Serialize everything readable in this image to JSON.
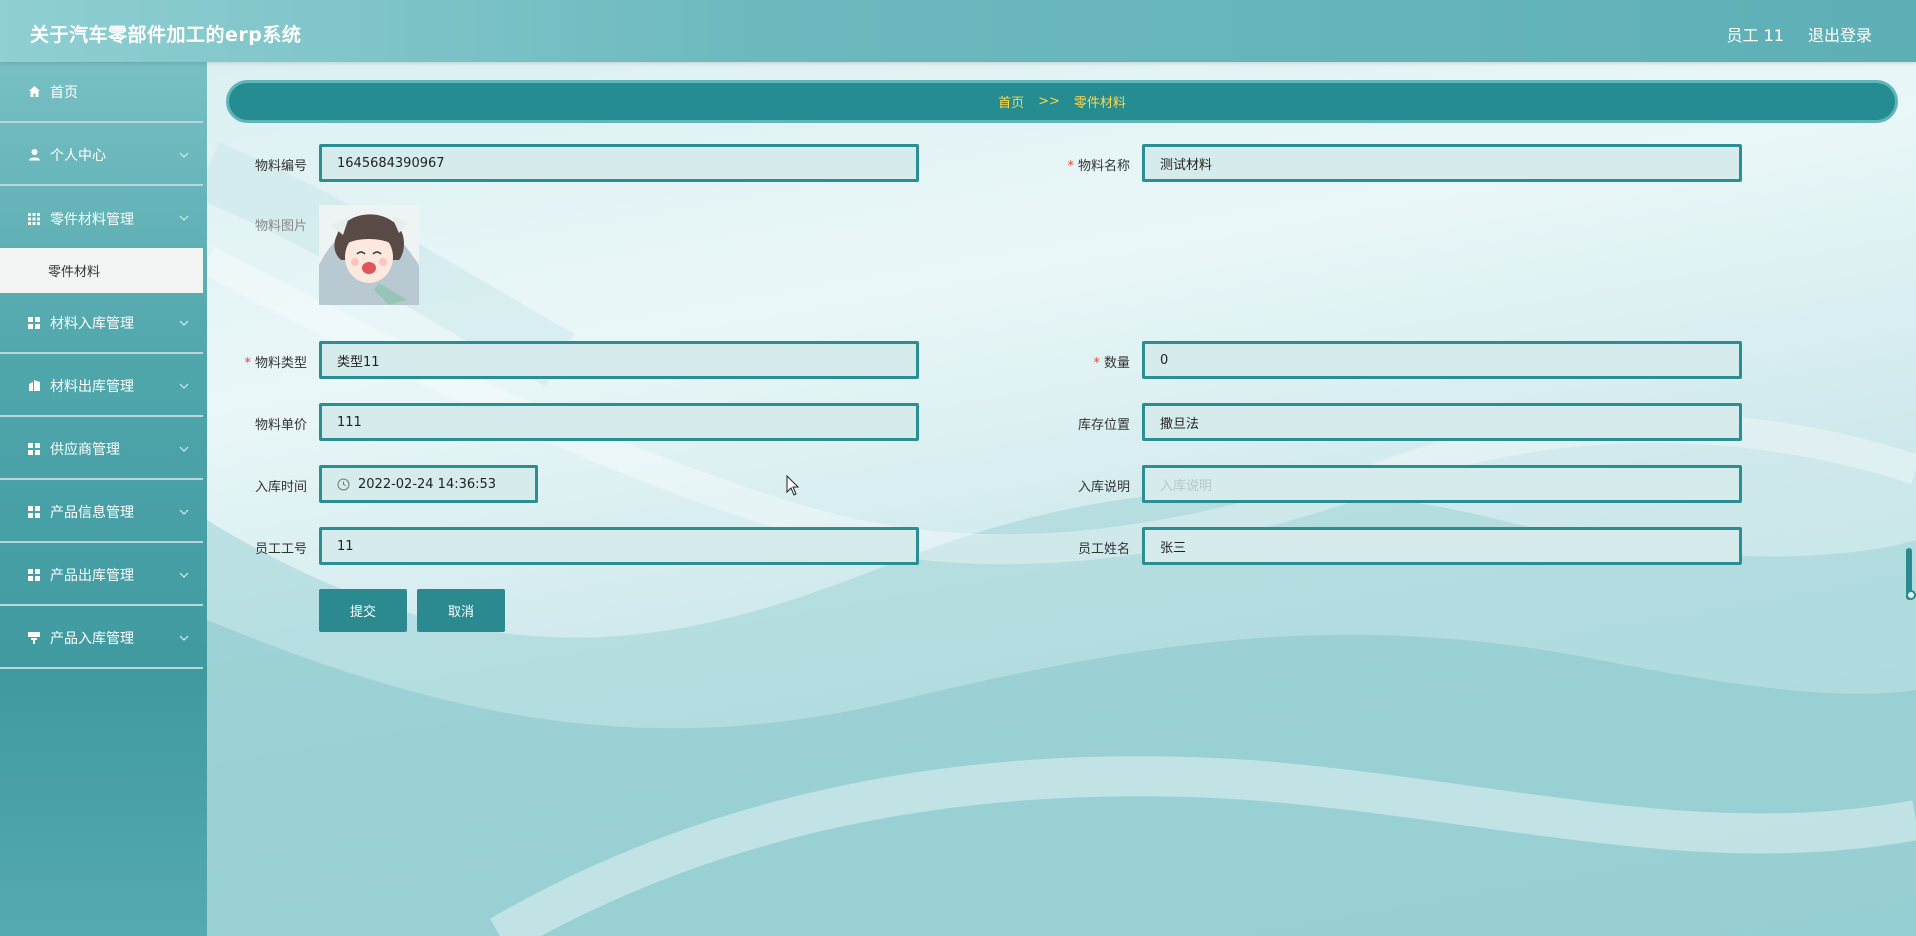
{
  "header": {
    "title": "关于汽车零部件加工的erp系统",
    "user": "员工 11",
    "logout": "退出登录"
  },
  "sidebar": {
    "items": [
      {
        "label": "首页",
        "icon": "home-icon"
      },
      {
        "label": "个人中心",
        "icon": "user-icon"
      },
      {
        "label": "零件材料管理",
        "icon": "grid-icon"
      },
      {
        "label": "材料入库管理",
        "icon": "grid-icon"
      },
      {
        "label": "材料出库管理",
        "icon": "building-icon"
      },
      {
        "label": "供应商管理",
        "icon": "grid-icon"
      },
      {
        "label": "产品信息管理",
        "icon": "grid-icon"
      },
      {
        "label": "产品出库管理",
        "icon": "grid-icon"
      },
      {
        "label": "产品入库管理",
        "icon": "desk-icon"
      }
    ],
    "active_sub": "零件材料"
  },
  "breadcrumb": {
    "home": "首页",
    "sep": ">>",
    "current": "零件材料",
    "color": "#ffd54a"
  },
  "form": {
    "material_no": {
      "label": "物料编号",
      "value": "1645684390967"
    },
    "material_name": {
      "label": "物料名称",
      "value": "测试材料",
      "required": true
    },
    "material_image": {
      "label": "物料图片"
    },
    "material_type": {
      "label": "物料类型",
      "value": "类型11",
      "required": true
    },
    "quantity": {
      "label": "数量",
      "value": "0",
      "required": true
    },
    "unit_price": {
      "label": "物料单价",
      "value": "111"
    },
    "storage_location": {
      "label": "库存位置",
      "value": "撒旦法"
    },
    "inbound_time": {
      "label": "入库时间",
      "value": "2022-02-24 14:36:53"
    },
    "inbound_note": {
      "label": "入库说明",
      "placeholder": "入库说明"
    },
    "employee_no": {
      "label": "员工工号",
      "value": "11"
    },
    "employee_name": {
      "label": "员工姓名",
      "value": "张三"
    }
  },
  "buttons": {
    "submit": "提交",
    "cancel": "取消"
  },
  "colors": {
    "accent": "#2a8a8f",
    "required": "#e0463c"
  }
}
